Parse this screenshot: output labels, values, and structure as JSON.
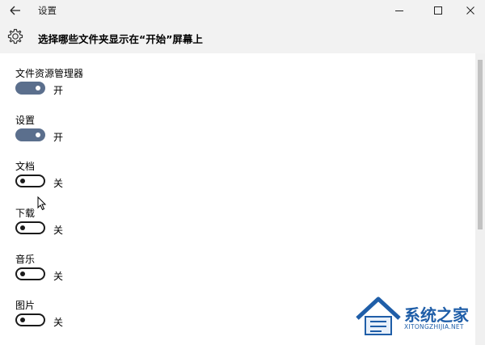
{
  "window": {
    "title": "设置",
    "back_icon": "arrow-left-icon",
    "minimize_icon": "minimize-icon",
    "maximize_icon": "maximize-icon",
    "close_icon": "close-icon"
  },
  "header": {
    "icon": "gear-icon",
    "title": "选择哪些文件夹显示在“开始”屏幕上"
  },
  "folders": [
    {
      "label": "文件资源管理器",
      "state": "开",
      "on": true
    },
    {
      "label": "设置",
      "state": "开",
      "on": true
    },
    {
      "label": "文档",
      "state": "关",
      "on": false
    },
    {
      "label": "下载",
      "state": "关",
      "on": false
    },
    {
      "label": "音乐",
      "state": "关",
      "on": false
    },
    {
      "label": "图片",
      "state": "关",
      "on": false
    }
  ],
  "colors": {
    "toggle_on": "#5b6f8d",
    "titlebar_bg": "#f2f2f2",
    "watermark": "#1f5ea8"
  },
  "watermark": {
    "brand": "系统之家",
    "url": "XITONGZHIJIA.NET"
  }
}
